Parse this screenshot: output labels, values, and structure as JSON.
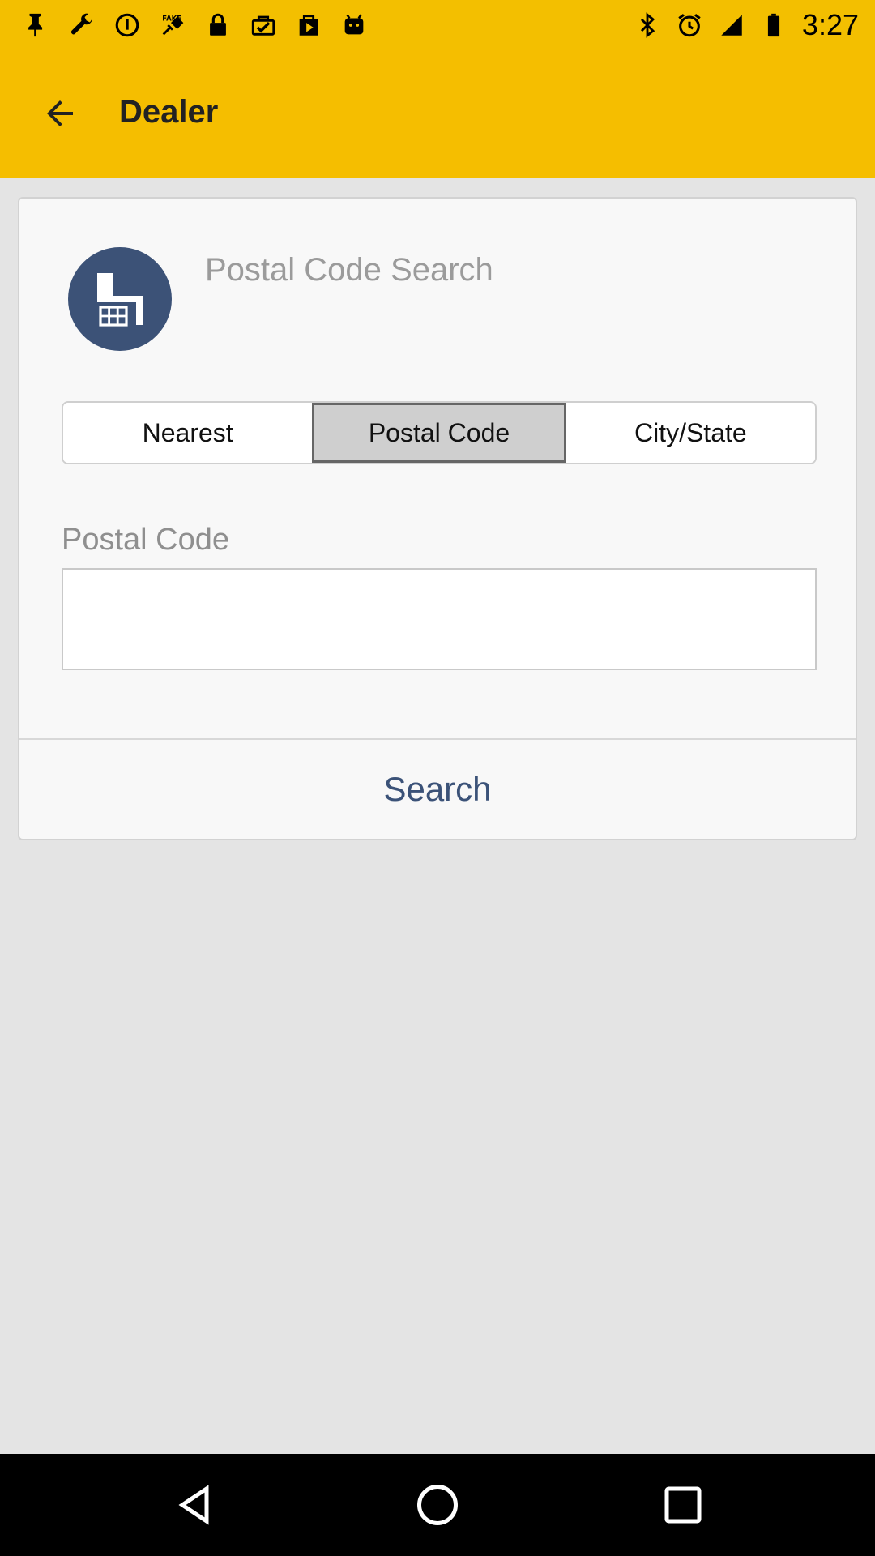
{
  "status_bar": {
    "time": "3:27",
    "left_icons": [
      "pin-icon",
      "wrench-icon",
      "info-icon",
      "fake-gps-icon",
      "lock-icon",
      "task-done-icon",
      "play-store-icon",
      "android-icon"
    ],
    "right_icons": [
      "bluetooth-icon",
      "alarm-icon",
      "signal-icon",
      "battery-icon"
    ]
  },
  "app_bar": {
    "title": "Dealer",
    "background_color": "#f5be00"
  },
  "card": {
    "title": "Postal Code Search",
    "avatar_color": "#3c5277",
    "tabs": [
      {
        "label": "Nearest",
        "active": false
      },
      {
        "label": "Postal Code",
        "active": true
      },
      {
        "label": "City/State",
        "active": false
      }
    ],
    "field_label": "Postal Code",
    "postal_input": {
      "value": "",
      "placeholder": ""
    },
    "search_label": "Search",
    "search_color": "#3b5278"
  },
  "nav_bar": {
    "buttons": [
      "back-icon",
      "home-icon",
      "recents-icon"
    ]
  }
}
